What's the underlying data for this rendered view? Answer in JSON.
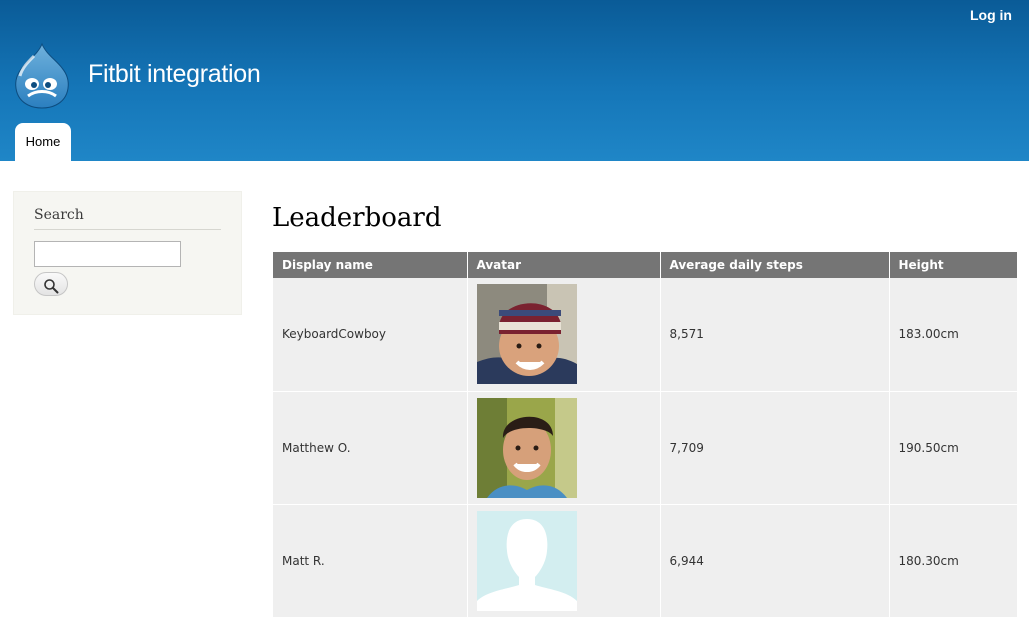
{
  "header": {
    "login_label": "Log in",
    "site_name": "Fitbit integration",
    "nav": [
      {
        "label": "Home"
      }
    ],
    "logo_icon": "drupal-drop-icon"
  },
  "sidebar": {
    "search": {
      "title": "Search",
      "value": "",
      "placeholder": "",
      "button_icon": "search-icon"
    }
  },
  "main": {
    "title": "Leaderboard",
    "table": {
      "columns": [
        "Display name",
        "Avatar",
        "Average daily steps",
        "Height"
      ],
      "rows": [
        {
          "display_name": "KeyboardCowboy",
          "avatar": "photo-avatar",
          "steps": "8,571",
          "height": "183.00cm"
        },
        {
          "display_name": "Matthew O.",
          "avatar": "photo-avatar",
          "steps": "7,709",
          "height": "190.50cm"
        },
        {
          "display_name": "Matt R.",
          "avatar": "default-avatar",
          "steps": "6,944",
          "height": "180.30cm"
        }
      ]
    }
  }
}
